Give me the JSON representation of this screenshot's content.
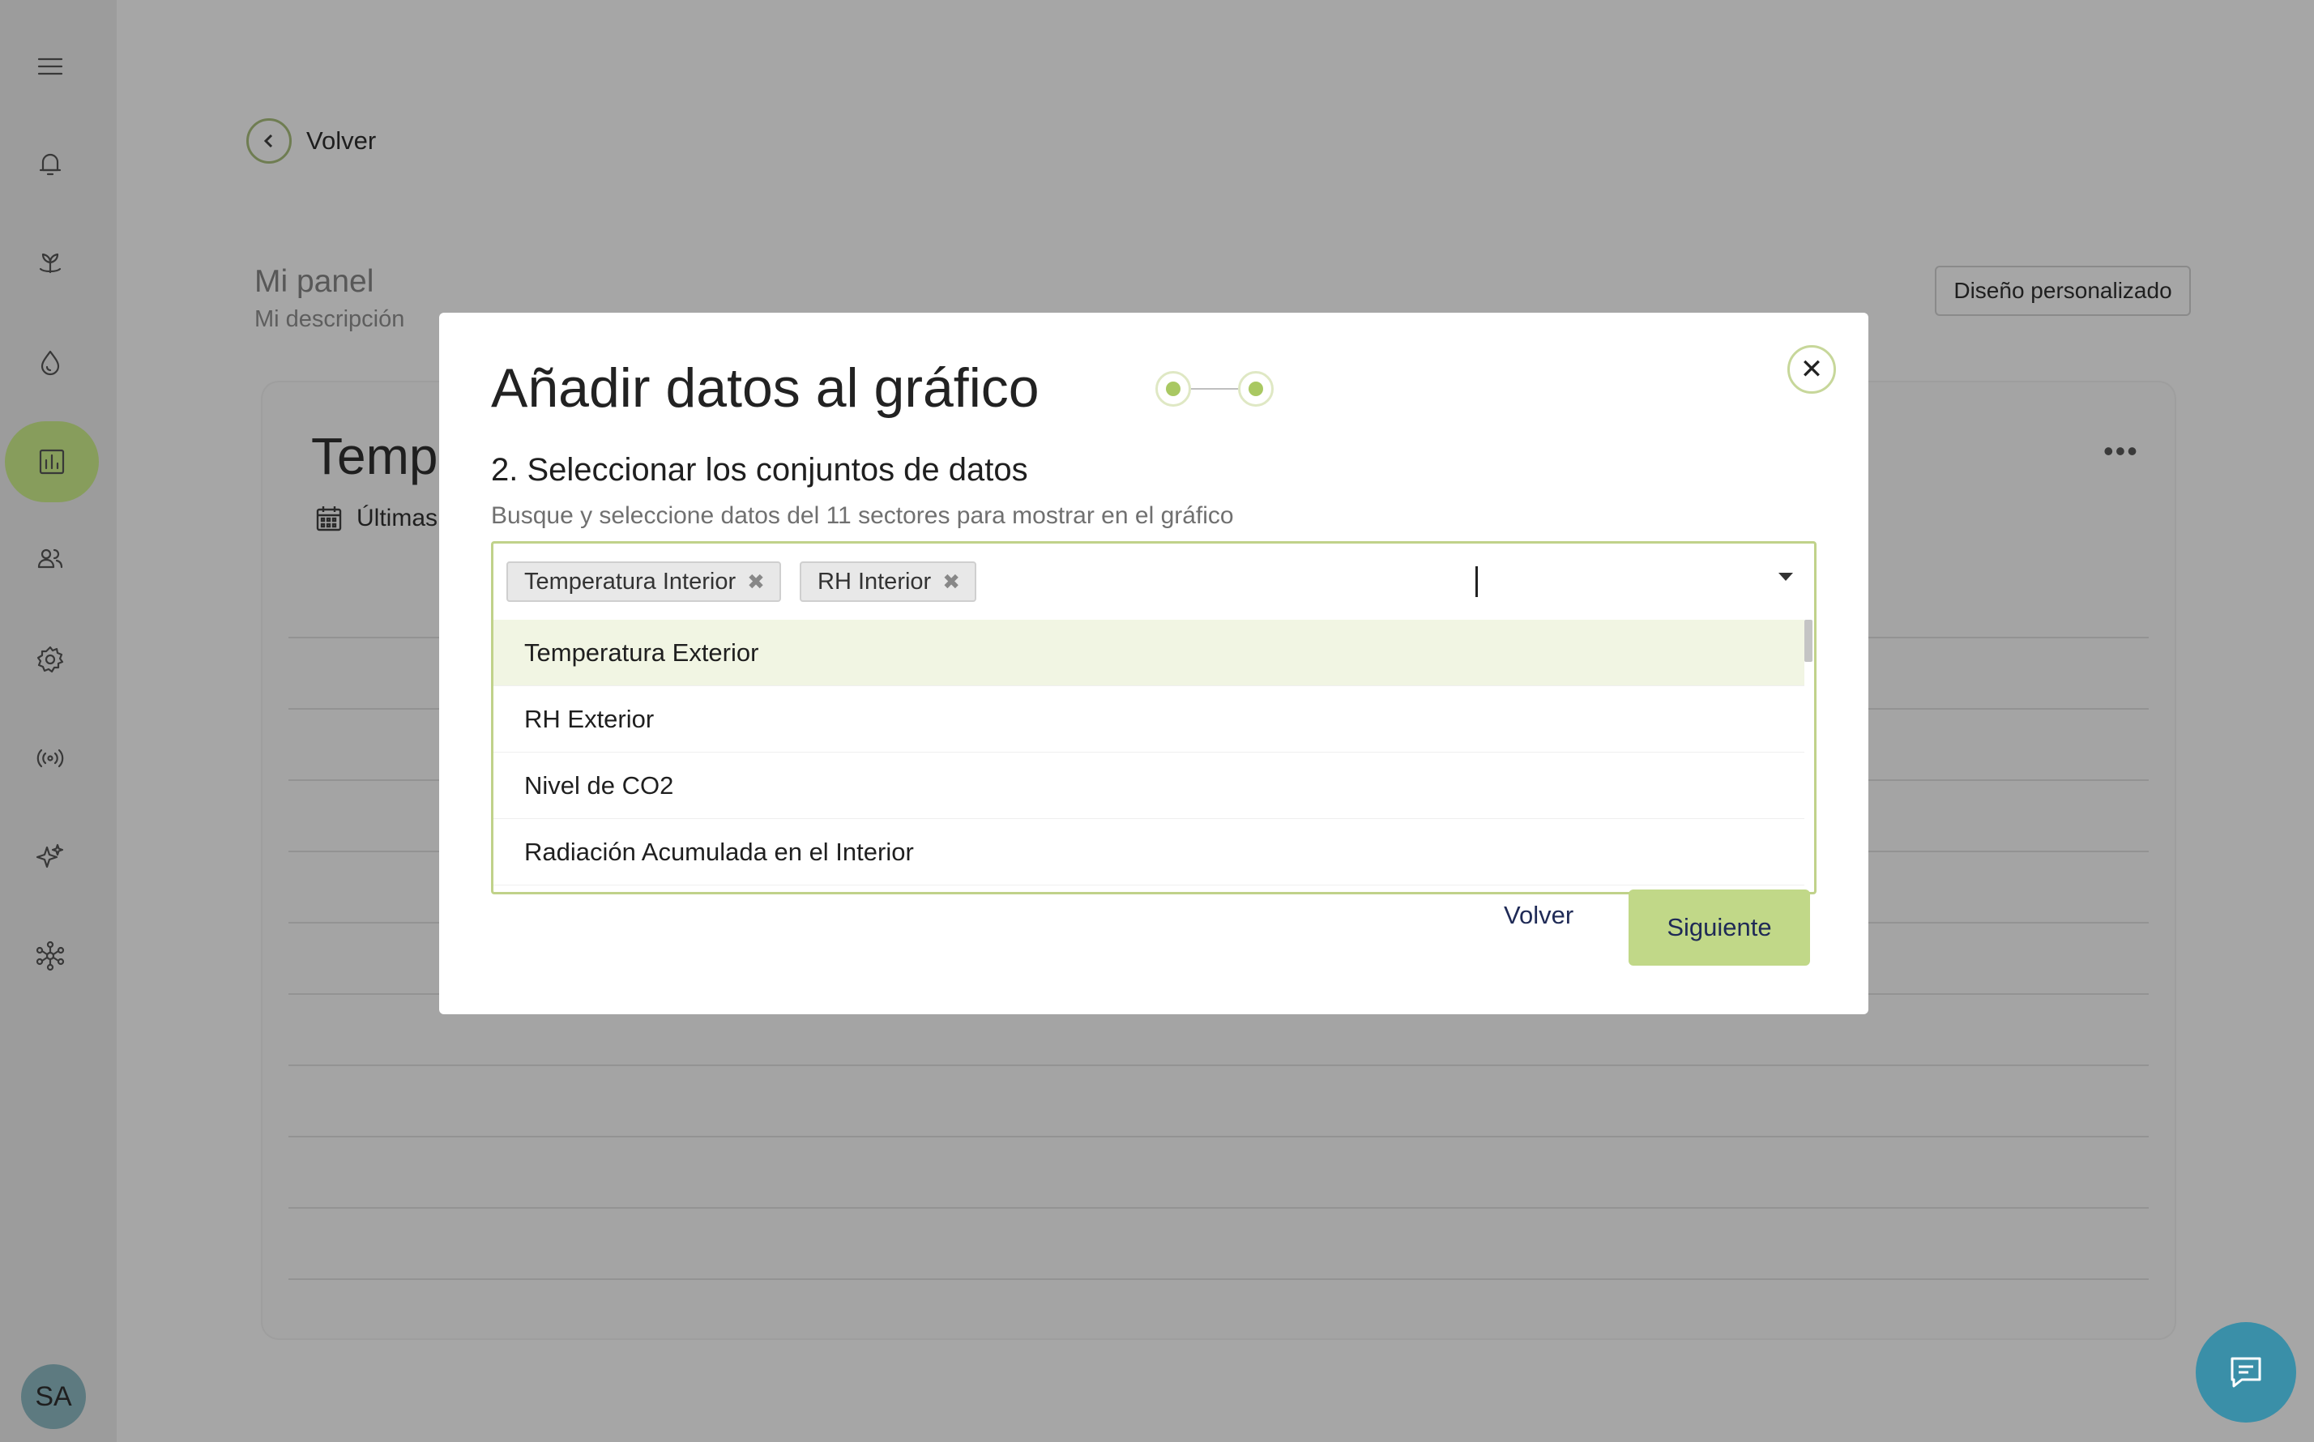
{
  "sidebar": {
    "items": [
      {
        "icon": "menu-icon"
      },
      {
        "icon": "bell-icon"
      },
      {
        "icon": "plant-icon"
      },
      {
        "icon": "drop-icon"
      },
      {
        "icon": "chart-icon",
        "active": true
      },
      {
        "icon": "users-icon"
      },
      {
        "icon": "gear-icon"
      },
      {
        "icon": "broadcast-icon"
      },
      {
        "icon": "sparkles-icon"
      },
      {
        "icon": "network-icon"
      }
    ],
    "avatar_initials": "SA"
  },
  "page": {
    "back_label": "Volver",
    "panel_title": "Mi panel",
    "panel_description": "Mi descripción",
    "custom_design_button": "Diseño personalizado",
    "card_title": "Temp",
    "card_subtitle": "Últimas",
    "card_menu": "•••"
  },
  "modal": {
    "title": "Añadir datos al gráfico",
    "close_label": "✕",
    "step_heading": "2. Seleccionar los conjuntos de datos",
    "step_help": "Busque y seleccione datos del 11 sectores para mostrar en el gráfico",
    "selected_chips": [
      {
        "label": "Temperatura Interior"
      },
      {
        "label": "RH Interior"
      }
    ],
    "chip_remove_glyph": "✖",
    "options": [
      {
        "label": "Temperatura Exterior"
      },
      {
        "label": "RH Exterior"
      },
      {
        "label": "Nivel de CO2"
      },
      {
        "label": "Radiación Acumulada en el Interior"
      }
    ],
    "back_button": "Volver",
    "next_button": "Siguiente"
  },
  "colors": {
    "accent": "#c1d888",
    "accent_dot": "#a9c862",
    "overlay_bg": "#a6a6a6",
    "chat_button": "#3a8fa8",
    "link_text": "#1f2a56"
  }
}
